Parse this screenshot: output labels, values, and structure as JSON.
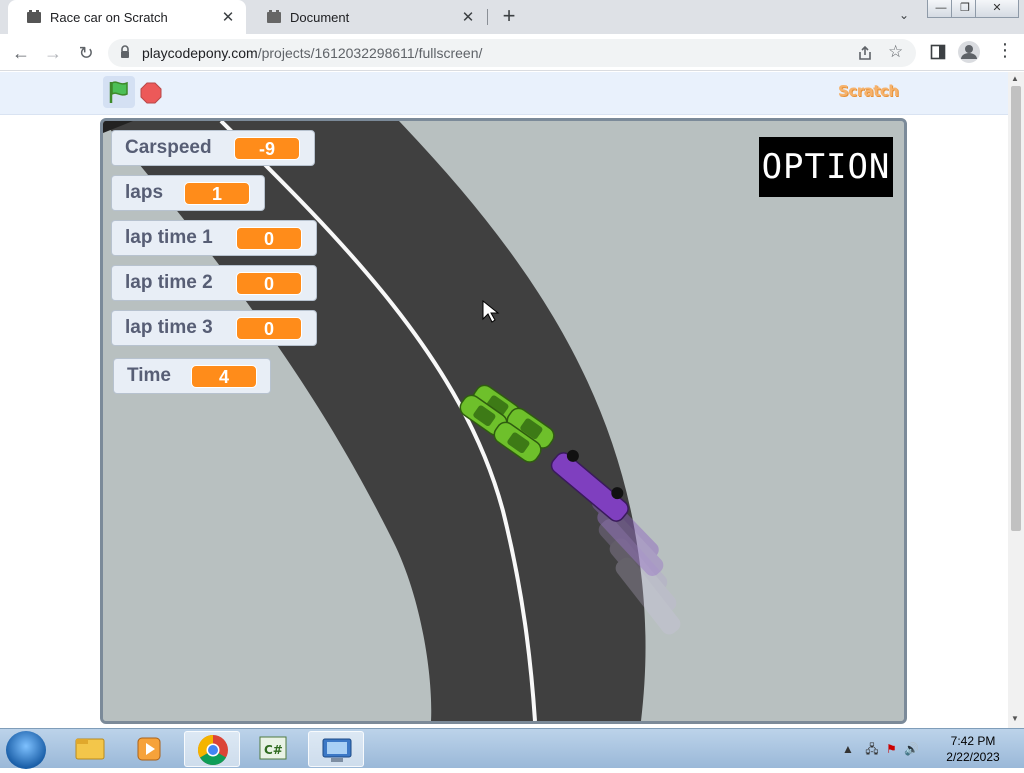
{
  "browser": {
    "tabs": [
      {
        "title": "Race car on Scratch",
        "active": true
      },
      {
        "title": "Document",
        "active": false
      }
    ],
    "new_tab_label": "+",
    "url_host": "playcodepony.com",
    "url_path": "/projects/1612032298611/fullscreen/"
  },
  "scratch": {
    "logo_text": "Scratch",
    "monitors": [
      {
        "label": "Carspeed",
        "value": "-9"
      },
      {
        "label": "laps",
        "value": "1"
      },
      {
        "label": "lap time 1",
        "value": "0"
      },
      {
        "label": "lap time 2",
        "value": "0"
      },
      {
        "label": "lap time 3",
        "value": "0"
      },
      {
        "label": "Time",
        "value": "4"
      }
    ],
    "option_label": "OPTION",
    "colors": {
      "monitor_value_bg": "#ff8c1a",
      "track": "#404040",
      "grass": "#b8c0c0",
      "player_car": "#7f3fbf",
      "opponent_car": "#6ec02b"
    }
  },
  "taskbar": {
    "time": "7:42 PM",
    "date": "2/22/2023",
    "icons": [
      "start-orb",
      "file-explorer",
      "media-player",
      "chrome",
      "csharp-editor",
      "remote-desktop"
    ]
  }
}
